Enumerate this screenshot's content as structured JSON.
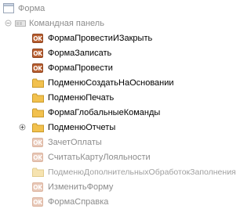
{
  "tree": {
    "root": {
      "label": "Форма",
      "icon": "form-icon"
    },
    "command_panel": {
      "label": "Командная панель",
      "icon": "command-panel-icon"
    },
    "items": [
      {
        "label": "ФормаПровестиИЗакрыть",
        "icon": "ok-icon",
        "enabled": true,
        "icon_text": "OK"
      },
      {
        "label": "ФормаЗаписать",
        "icon": "ok-icon",
        "enabled": true,
        "icon_text": "OK"
      },
      {
        "label": "ФормаПровести",
        "icon": "ok-icon",
        "enabled": true,
        "icon_text": "OK"
      },
      {
        "label": "ПодменюСоздатьНаОсновании",
        "icon": "folder-icon",
        "enabled": true
      },
      {
        "label": "ПодменюПечать",
        "icon": "folder-icon",
        "enabled": true
      },
      {
        "label": "ФормаГлобальныеКоманды",
        "icon": "folder-icon",
        "enabled": true
      },
      {
        "label": "ПодменюОтчеты",
        "icon": "folder-icon",
        "enabled": true,
        "expandable": true
      },
      {
        "label": "ЗачетОплаты",
        "icon": "ok-icon",
        "enabled": false,
        "icon_text": "OK"
      },
      {
        "label": "СчитатьКартуЛояльности",
        "icon": "ok-icon",
        "enabled": false,
        "icon_text": "OK"
      },
      {
        "label": "ПодменюДополнительныхОбработокЗаполнения",
        "icon": "folder-icon",
        "enabled": false
      },
      {
        "label": "ИзменитьФорму",
        "icon": "ok-icon",
        "enabled": false,
        "icon_text": "OK"
      },
      {
        "label": "ФормаСправка",
        "icon": "ok-icon",
        "enabled": false,
        "icon_text": "OK"
      }
    ]
  },
  "colors": {
    "ok_active": "#b85e2f",
    "ok_inactive": "#e8c8b8",
    "folder_active": "#f2c14e",
    "folder_inactive": "#f6e3b0",
    "dim_text": "#8c8c8c"
  }
}
